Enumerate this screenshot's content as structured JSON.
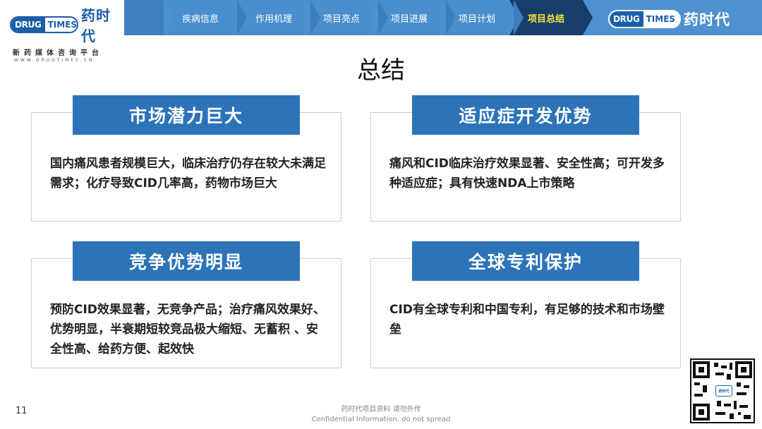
{
  "header": {
    "logo": {
      "drug": "DRUG",
      "times": "TIMES",
      "name": "药时代",
      "subtitle": "新药媒体咨询平台",
      "url": "WWW.DRUGTIMES.CN"
    },
    "nav": [
      {
        "label": "疾病信息",
        "active": false
      },
      {
        "label": "作用机理",
        "active": false
      },
      {
        "label": "项目亮点",
        "active": false
      },
      {
        "label": "项目进展",
        "active": false
      },
      {
        "label": "项目计划",
        "active": false
      },
      {
        "label": "项目总结",
        "active": true
      }
    ],
    "logo_right": {
      "drug": "DRUG",
      "times": "TIMES",
      "name": "药时代"
    }
  },
  "page_title": "总结",
  "cards": [
    {
      "title": "市场潜力巨大",
      "body": "国内痛风患者规模巨大，临床治疗仍存在较大未满足需求；化疗导致CID几率高，药物市场巨大"
    },
    {
      "title": "适应症开发优势",
      "body": "痛风和CID临床治疗效果显著、安全性高；可开发多种适应症；具有快速NDA上市策略"
    },
    {
      "title": "竞争优势明显",
      "body": "预防CID效果显著，无竞争产品；治疗痛风效果好、优势明显，半衰期短较竞品极大缩短、无蓄积 、安全性高、给药方便、起效快"
    },
    {
      "title": "全球专利保护",
      "body": "CID有全球专利和中国专利，有足够的技术和市场壁垒"
    }
  ],
  "footer": {
    "page_number": "11",
    "confidential_cn": "药时代项目资料 请勿外传",
    "confidential_en": "Confidential Information, do not spread",
    "qr_label": "药时代"
  },
  "colors": {
    "nav_bg": "#4d92cf",
    "nav_active_bg": "#173e6b",
    "nav_active_text": "#f7e43a",
    "card_head": "#2c73b8",
    "brand": "#1a5ea8"
  }
}
